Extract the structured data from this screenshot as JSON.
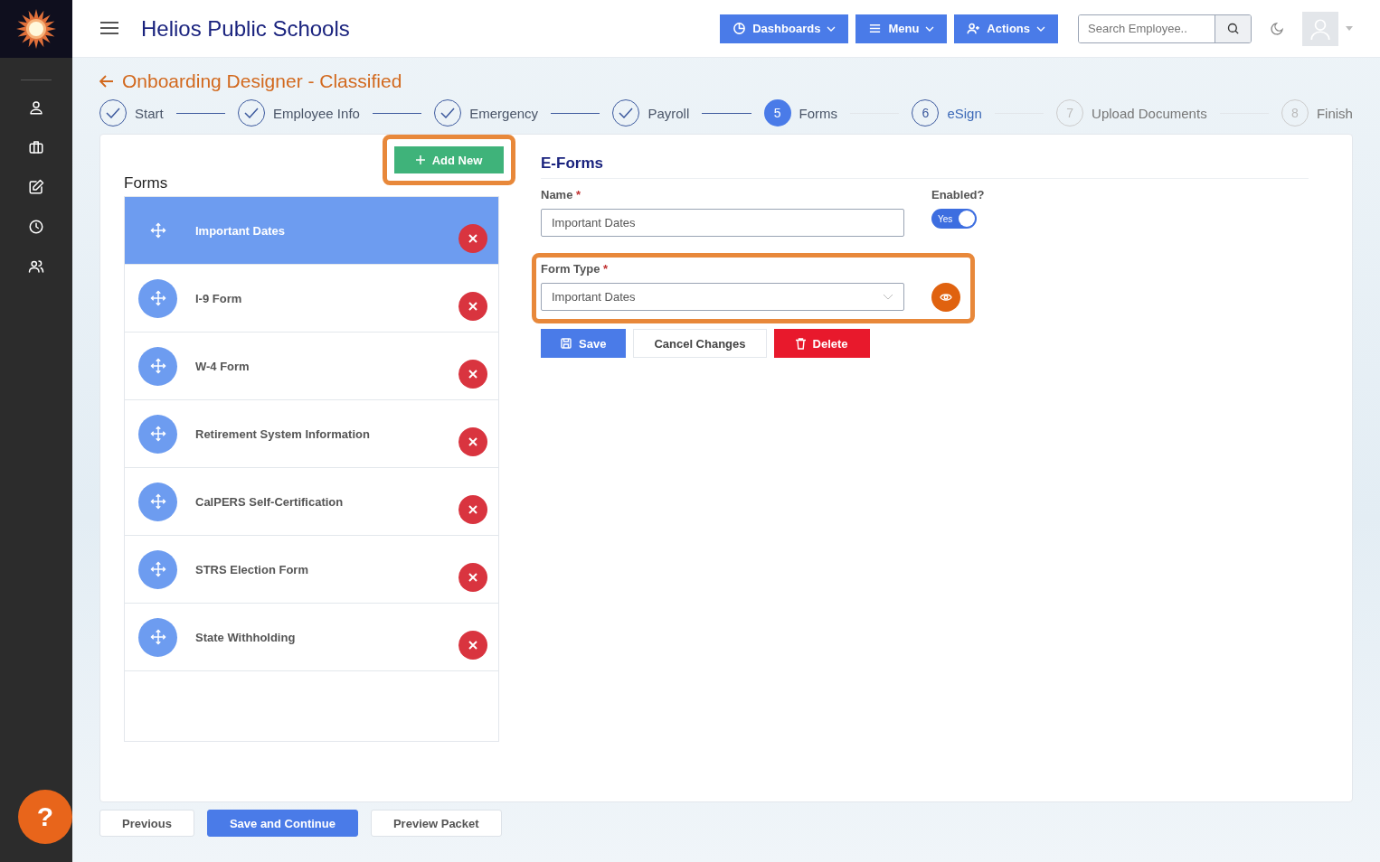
{
  "header": {
    "title": "Helios Public Schools",
    "nav_buttons": [
      {
        "label": "Dashboards"
      },
      {
        "label": "Menu"
      },
      {
        "label": "Actions"
      }
    ],
    "search": {
      "placeholder": "Search Employee.."
    }
  },
  "page": {
    "back_title": "Onboarding Designer - Classified"
  },
  "steps": [
    {
      "label": "Start",
      "kind": "done"
    },
    {
      "label": "Employee Info",
      "kind": "done"
    },
    {
      "label": "Emergency",
      "kind": "done"
    },
    {
      "label": "Payroll",
      "kind": "done"
    },
    {
      "label": "Forms",
      "number": "5",
      "kind": "current"
    },
    {
      "label": "eSign",
      "number": "6",
      "kind": "next"
    },
    {
      "label": "Upload Documents",
      "number": "7",
      "kind": "upcoming"
    },
    {
      "label": "Finish",
      "number": "8",
      "kind": "upcoming"
    }
  ],
  "forms_panel": {
    "add_button": {
      "label": "Add New",
      "highlighted": true
    },
    "heading": "Forms",
    "items": [
      {
        "name": "Important Dates",
        "selected": true
      },
      {
        "name": "I-9 Form",
        "selected": false
      },
      {
        "name": "W-4 Form",
        "selected": false
      },
      {
        "name": "Retirement System Information",
        "selected": false
      },
      {
        "name": "CalPERS Self-Certification",
        "selected": false
      },
      {
        "name": "STRS Election Form",
        "selected": false
      },
      {
        "name": "State Withholding",
        "selected": false
      }
    ]
  },
  "editor": {
    "title": "E-Forms",
    "name_label": "Name",
    "name_required": "*",
    "name_value": "Important Dates",
    "enabled_label": "Enabled?",
    "enabled": {
      "on": true,
      "label": "Yes"
    },
    "form_type": {
      "label": "Form Type",
      "required": "*",
      "value": "Important Dates",
      "highlighted": true
    },
    "buttons": [
      {
        "label": "Save",
        "kind": "primary"
      },
      {
        "label": "Cancel Changes",
        "kind": "secondary"
      },
      {
        "label": "Delete",
        "kind": "danger"
      }
    ]
  },
  "footer_buttons": [
    {
      "label": "Previous",
      "kind": "secondary"
    },
    {
      "label": "Save and Continue",
      "kind": "primary"
    },
    {
      "label": "Preview Packet",
      "kind": "secondary"
    }
  ],
  "help": {
    "label": "?"
  }
}
